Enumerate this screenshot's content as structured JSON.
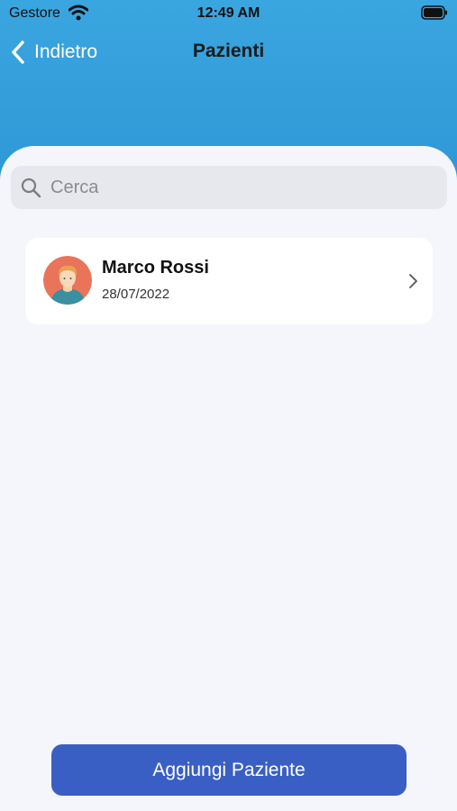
{
  "status_bar": {
    "carrier": "Gestore",
    "time": "12:49 AM"
  },
  "nav": {
    "back_label": "Indietro",
    "title": "Pazienti"
  },
  "search": {
    "placeholder": "Cerca",
    "value": ""
  },
  "patients": [
    {
      "name": "Marco Rossi",
      "date": "28/07/2022"
    }
  ],
  "actions": {
    "add_patient_label": "Aggiungi Paziente"
  },
  "colors": {
    "header": "#3aa6e0",
    "content_bg": "#f4f6fb",
    "primary_button": "#3a5fc4"
  }
}
